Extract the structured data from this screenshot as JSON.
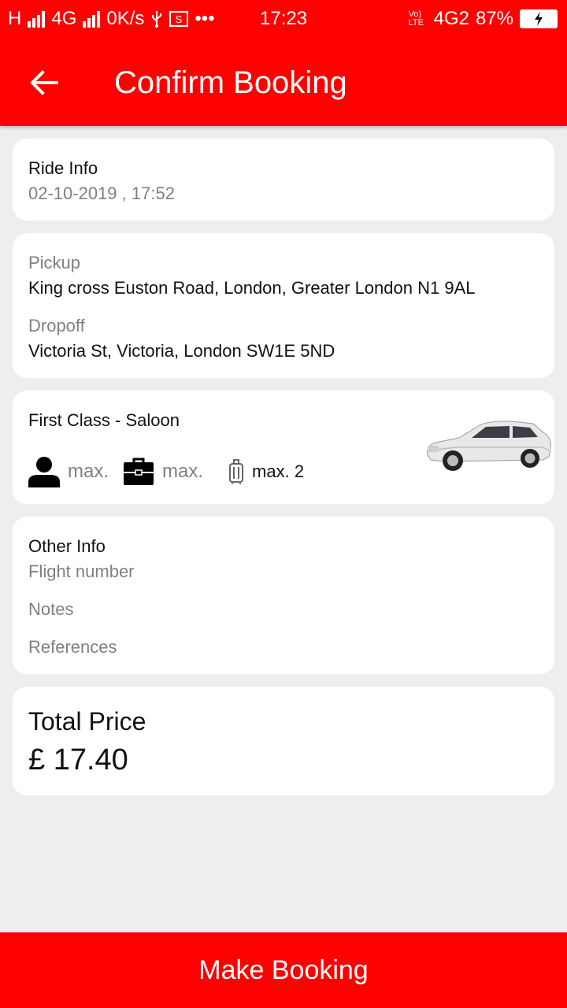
{
  "status_bar": {
    "network_left": "H",
    "network_mid": "4G",
    "speed": "0K/s",
    "more": "•••",
    "time": "17:23",
    "volte": "Vo) LTE",
    "network_right": "4G2",
    "battery_percent": "87%"
  },
  "header": {
    "title": "Confirm Booking",
    "accent_color": "#fe0000"
  },
  "ride_info": {
    "heading": "Ride Info",
    "datetime": "02-10-2019 , 17:52"
  },
  "route": {
    "pickup_label": "Pickup",
    "pickup_address": "King cross Euston Road, London, Greater London N1 9AL",
    "dropoff_label": "Dropoff",
    "dropoff_address": "Victoria St, Victoria, London SW1E 5ND"
  },
  "vehicle": {
    "class_name": "First Class - Saloon",
    "passengers_label": "max.",
    "bags_label": "max.",
    "luggage_label": "max. 2",
    "icons": [
      "person-icon",
      "briefcase-icon",
      "luggage-icon",
      "car-image"
    ]
  },
  "other_info": {
    "heading": "Other Info",
    "flight_number_label": "Flight number",
    "notes_label": "Notes",
    "references_label": "References"
  },
  "total": {
    "heading": "Total Price",
    "amount": "£ 17.40"
  },
  "footer": {
    "button_label": "Make Booking"
  }
}
